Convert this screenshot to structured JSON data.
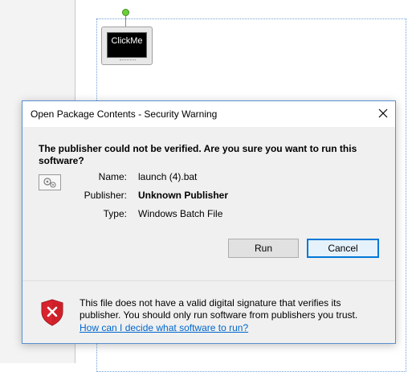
{
  "background": {
    "ole_object_label": "ClickMe"
  },
  "dialog": {
    "title": "Open Package Contents - Security Warning",
    "question": "The publisher could not be verified.  Are you sure you want to run this software?",
    "fields": {
      "name_label": "Name:",
      "name_value": "launch (4).bat",
      "publisher_label": "Publisher:",
      "publisher_value": "Unknown Publisher",
      "type_label": "Type:",
      "type_value": "Windows Batch File"
    },
    "buttons": {
      "run_label": "Run",
      "cancel_label": "Cancel"
    },
    "warning": {
      "text": "This file does not have a valid digital signature that verifies its publisher.  You should only run software from publishers you trust.",
      "link": "How can I decide what software to run?"
    }
  },
  "icons": {
    "close": "close-icon",
    "file": "file-settings-icon",
    "shield": "shield-error-icon"
  },
  "colors": {
    "accent": "#0078d7",
    "link": "#0066cc",
    "shield_red": "#d9232d",
    "dialog_border": "#5a8fd0"
  }
}
